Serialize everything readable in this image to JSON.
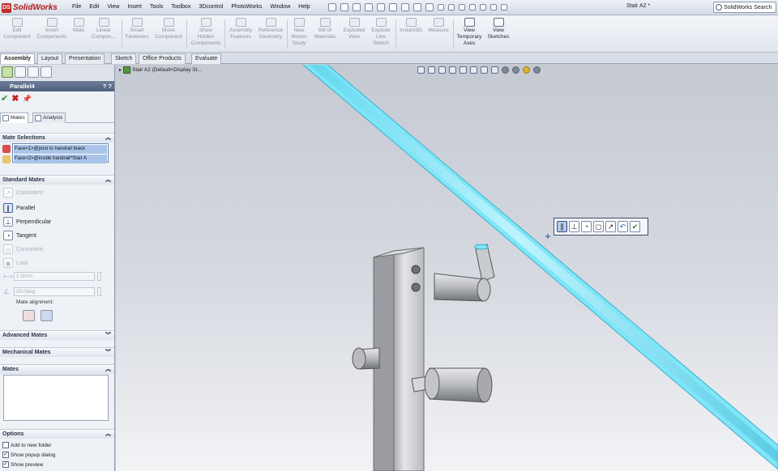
{
  "app": {
    "logo_text": "SolidWorks",
    "document_title": "Stair A2 *"
  },
  "menus": [
    "File",
    "Edit",
    "View",
    "Insert",
    "Tools",
    "Toolbox",
    "3Dcontrol",
    "PhotoWorks",
    "Window",
    "Help"
  ],
  "search": {
    "placeholder": "SolidWorks Search"
  },
  "commands": [
    {
      "label": "Edit\nComponent",
      "enabled": false
    },
    {
      "label": "Insert\nComponents",
      "enabled": false
    },
    {
      "label": "Mate",
      "enabled": false
    },
    {
      "label": "Linear\nCompon...",
      "enabled": false
    },
    {
      "label": "Smart\nFasteners",
      "enabled": false
    },
    {
      "label": "Move\nComponent",
      "enabled": false
    },
    {
      "label": "Show\nHidden\nComponents",
      "enabled": false
    },
    {
      "label": "Assembly\nFeatures",
      "enabled": false
    },
    {
      "label": "Reference\nGeometry",
      "enabled": false
    },
    {
      "label": "New\nMotion\nStudy",
      "enabled": false
    },
    {
      "label": "Bill of\nMaterials",
      "enabled": false
    },
    {
      "label": "Exploded\nView",
      "enabled": false
    },
    {
      "label": "Explode\nLine\nSketch",
      "enabled": false
    },
    {
      "label": "Instant3D",
      "enabled": false
    },
    {
      "label": "Measure",
      "enabled": false
    },
    {
      "label": "View\nTemporary\nAxes",
      "enabled": true
    },
    {
      "label": "View\nSketches",
      "enabled": true
    }
  ],
  "tabs": [
    "Assembly",
    "Layout",
    "Presentation",
    "Sketch",
    "Office Products",
    "Evaluate"
  ],
  "active_tab": "Assembly",
  "property_manager": {
    "title": "Parallel4",
    "help": "? ?",
    "subtabs": [
      "Mates",
      "Analysis"
    ],
    "sections": {
      "mate_selections": "Mate Selections",
      "standard_mates": "Standard Mates",
      "advanced_mates": "Advanced Mates",
      "mechanical_mates": "Mechanical Mates",
      "mates": "Mates",
      "options": "Options"
    },
    "selections": [
      "Face<1>@post to handrail brack",
      "Face<2>@inside handrail^Stair A"
    ],
    "standard_mates": [
      {
        "label": "Coincident",
        "enabled": false,
        "selected": false,
        "glyph": "↗"
      },
      {
        "label": "Parallel",
        "enabled": true,
        "selected": true,
        "glyph": "∥"
      },
      {
        "label": "Perpendicular",
        "enabled": true,
        "selected": false,
        "glyph": "⊥"
      },
      {
        "label": "Tangent",
        "enabled": true,
        "selected": false,
        "glyph": "◔"
      },
      {
        "label": "Concentric",
        "enabled": false,
        "selected": false,
        "glyph": "◎"
      },
      {
        "label": "Lock",
        "enabled": false,
        "selected": false,
        "glyph": "🔒"
      }
    ],
    "distance_value": "1.0mm",
    "angle_value": "30.0deg",
    "mate_alignment_label": "Mate alignment:",
    "options": [
      {
        "label": "Add to new folder",
        "checked": false
      },
      {
        "label": "Show popup dialog",
        "checked": true
      },
      {
        "label": "Show preview",
        "checked": true
      }
    ]
  },
  "tree": {
    "label": "Stair A2  (Default<Display St..."
  },
  "context_toolbar": [
    "∥",
    "⊥",
    "◔",
    "◻",
    "↗",
    "↶",
    "✔"
  ],
  "colors": {
    "handrail": "#7fe6f7",
    "viewport_top": "#c5c9d2",
    "viewport_bottom": "#f2f3f5",
    "accent": "#5b6d8f"
  }
}
